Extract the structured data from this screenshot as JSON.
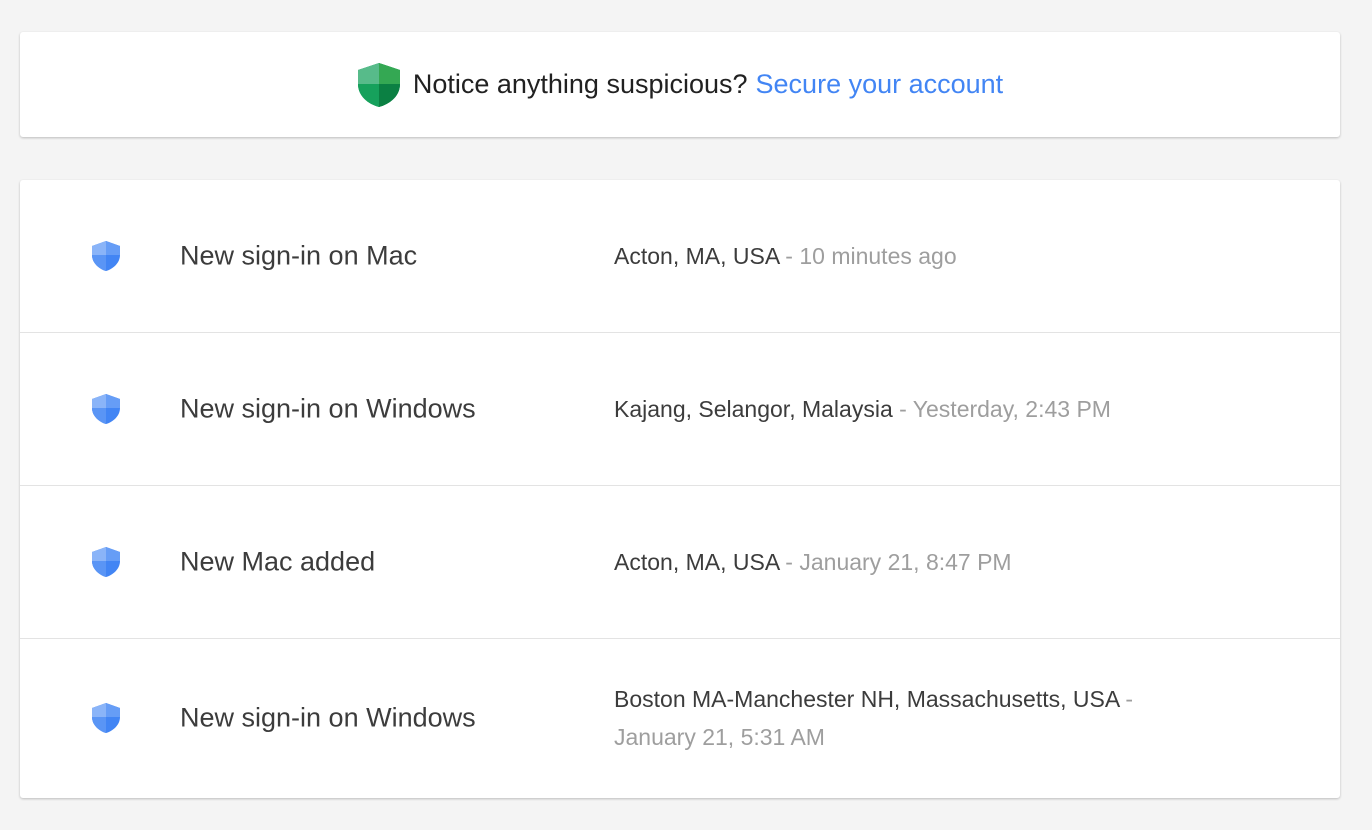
{
  "notice": {
    "text": "Notice anything suspicious?",
    "link_label": "Secure your account",
    "icon": "shield-check-icon"
  },
  "colors": {
    "accent": "#4285f4",
    "notice_shield": "#0f9d58",
    "row_shield": "#4285f4",
    "background": "#f4f4f4",
    "secondary_text": "#9e9e9e"
  },
  "activity": {
    "separator": "-",
    "items": [
      {
        "title": "New sign-in on Mac",
        "location": "Acton, MA, USA",
        "time": "10 minutes ago",
        "icon": "shield-icon"
      },
      {
        "title": "New sign-in on Windows",
        "location": "Kajang, Selangor, Malaysia",
        "time": "Yesterday, 2:43 PM",
        "icon": "shield-icon"
      },
      {
        "title": "New Mac added",
        "location": "Acton, MA, USA",
        "time": "January 21, 8:47 PM",
        "icon": "shield-icon"
      },
      {
        "title": "New sign-in on Windows",
        "location": "Boston MA-Manchester NH, Massachusetts, USA",
        "time": "January 21, 5:31 AM",
        "icon": "shield-icon"
      }
    ]
  }
}
